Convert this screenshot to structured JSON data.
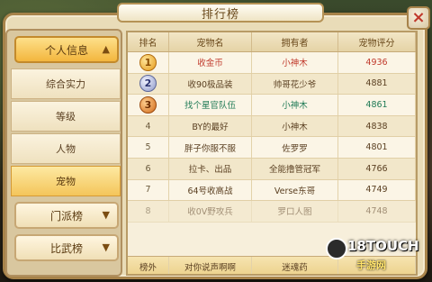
{
  "window": {
    "title": "排行榜",
    "title_deco_left": "• • •",
    "title_deco_right": "• • •",
    "close_label": "×"
  },
  "sidebar": {
    "category_top": {
      "label": "个人信息",
      "chevron": "▲"
    },
    "sub_items": [
      {
        "label": "综合实力"
      },
      {
        "label": "等级"
      },
      {
        "label": "人物"
      },
      {
        "label": "宠物",
        "active": true
      }
    ],
    "categories_bottom": [
      {
        "label": "门派榜",
        "chevron": "▼"
      },
      {
        "label": "比武榜",
        "chevron": "▼"
      }
    ]
  },
  "table": {
    "headers": [
      "排名",
      "宠物名",
      "拥有者",
      "宠物评分"
    ],
    "rows": [
      {
        "rank": "1",
        "medal": "gold",
        "pet": "收金币",
        "owner": "小神木",
        "score": "4936",
        "pet_color": "#c0392b",
        "owner_color": "#c0392b",
        "score_color": "#c0392b"
      },
      {
        "rank": "2",
        "medal": "silver",
        "pet": "收90极品装",
        "owner": "帅哥花少爷",
        "score": "4881",
        "pet_color": "#5b4022",
        "owner_color": "#5b4022",
        "score_color": "#5b4022"
      },
      {
        "rank": "3",
        "medal": "bronze",
        "pet": "找个星官队伍",
        "owner": "小神木",
        "score": "4861",
        "pet_color": "#1f7a55",
        "owner_color": "#1f7a55",
        "score_color": "#1f7a55"
      },
      {
        "rank": "4",
        "pet": "BY的最好",
        "owner": "小神木",
        "score": "4838"
      },
      {
        "rank": "5",
        "pet": "胖子你服不服",
        "owner": "佐罗罗",
        "score": "4801"
      },
      {
        "rank": "6",
        "pet": "拉卡、出品",
        "owner": "全能撸管冠军",
        "score": "4766"
      },
      {
        "rank": "7",
        "pet": "64号收高战",
        "owner": "Verse东哥",
        "score": "4749"
      },
      {
        "rank": "8",
        "pet": "收0V野攻兵",
        "owner": "罗口人图",
        "score": "4748"
      }
    ],
    "footer": {
      "rank": "榜外",
      "pet": "对你说声啊啊",
      "owner": "迷魂药",
      "score": ""
    }
  },
  "watermark": {
    "line1": "18TOUCH",
    "line2": "手游网"
  },
  "colors": {
    "frame": "#e9dcb8",
    "accent_gold": "#f3b63e",
    "rank1": "#c0392b",
    "rank3": "#1f7a55"
  }
}
